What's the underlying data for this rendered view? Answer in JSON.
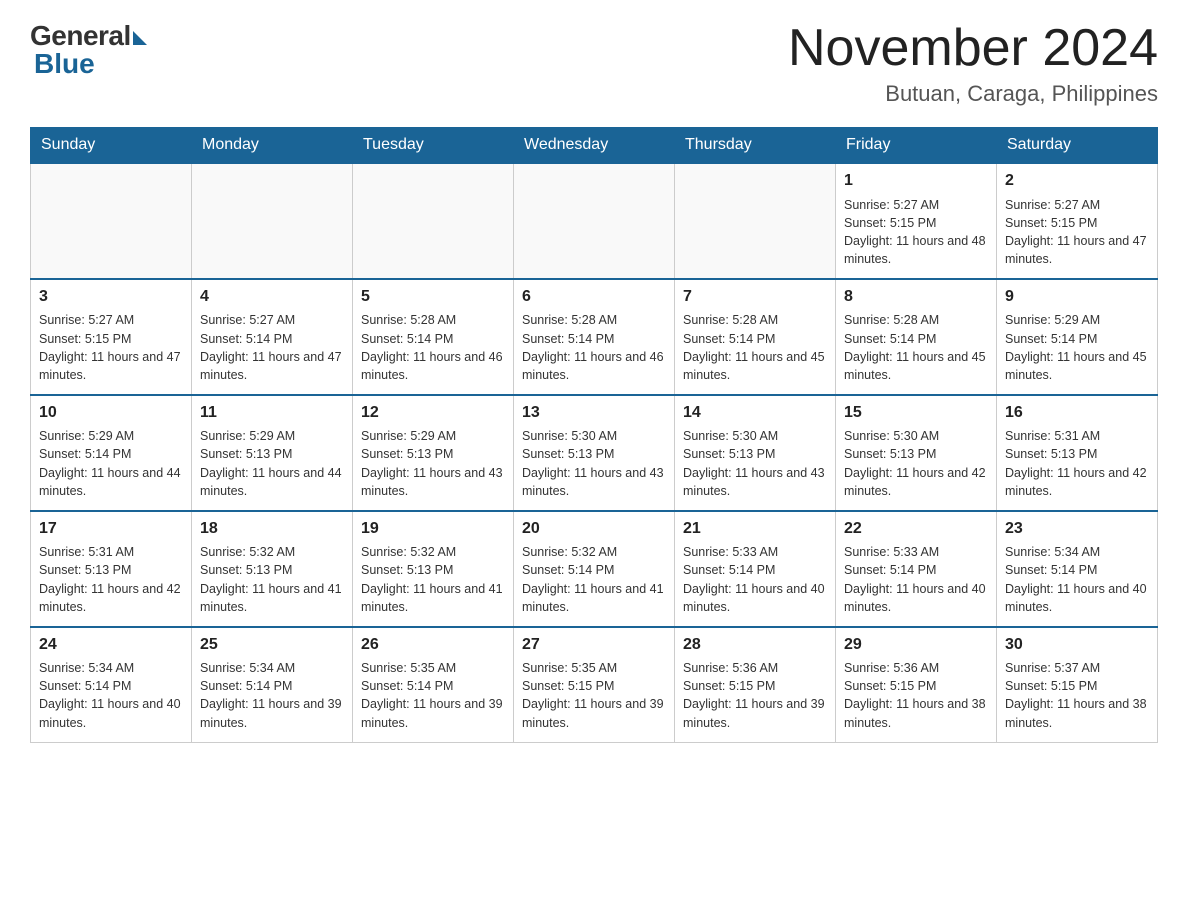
{
  "header": {
    "logo_general": "General",
    "logo_blue": "Blue",
    "title": "November 2024",
    "location": "Butuan, Caraga, Philippines"
  },
  "days_of_week": [
    "Sunday",
    "Monday",
    "Tuesday",
    "Wednesday",
    "Thursday",
    "Friday",
    "Saturday"
  ],
  "weeks": [
    [
      {
        "day": "",
        "info": ""
      },
      {
        "day": "",
        "info": ""
      },
      {
        "day": "",
        "info": ""
      },
      {
        "day": "",
        "info": ""
      },
      {
        "day": "",
        "info": ""
      },
      {
        "day": "1",
        "info": "Sunrise: 5:27 AM\nSunset: 5:15 PM\nDaylight: 11 hours and 48 minutes."
      },
      {
        "day": "2",
        "info": "Sunrise: 5:27 AM\nSunset: 5:15 PM\nDaylight: 11 hours and 47 minutes."
      }
    ],
    [
      {
        "day": "3",
        "info": "Sunrise: 5:27 AM\nSunset: 5:15 PM\nDaylight: 11 hours and 47 minutes."
      },
      {
        "day": "4",
        "info": "Sunrise: 5:27 AM\nSunset: 5:14 PM\nDaylight: 11 hours and 47 minutes."
      },
      {
        "day": "5",
        "info": "Sunrise: 5:28 AM\nSunset: 5:14 PM\nDaylight: 11 hours and 46 minutes."
      },
      {
        "day": "6",
        "info": "Sunrise: 5:28 AM\nSunset: 5:14 PM\nDaylight: 11 hours and 46 minutes."
      },
      {
        "day": "7",
        "info": "Sunrise: 5:28 AM\nSunset: 5:14 PM\nDaylight: 11 hours and 45 minutes."
      },
      {
        "day": "8",
        "info": "Sunrise: 5:28 AM\nSunset: 5:14 PM\nDaylight: 11 hours and 45 minutes."
      },
      {
        "day": "9",
        "info": "Sunrise: 5:29 AM\nSunset: 5:14 PM\nDaylight: 11 hours and 45 minutes."
      }
    ],
    [
      {
        "day": "10",
        "info": "Sunrise: 5:29 AM\nSunset: 5:14 PM\nDaylight: 11 hours and 44 minutes."
      },
      {
        "day": "11",
        "info": "Sunrise: 5:29 AM\nSunset: 5:13 PM\nDaylight: 11 hours and 44 minutes."
      },
      {
        "day": "12",
        "info": "Sunrise: 5:29 AM\nSunset: 5:13 PM\nDaylight: 11 hours and 43 minutes."
      },
      {
        "day": "13",
        "info": "Sunrise: 5:30 AM\nSunset: 5:13 PM\nDaylight: 11 hours and 43 minutes."
      },
      {
        "day": "14",
        "info": "Sunrise: 5:30 AM\nSunset: 5:13 PM\nDaylight: 11 hours and 43 minutes."
      },
      {
        "day": "15",
        "info": "Sunrise: 5:30 AM\nSunset: 5:13 PM\nDaylight: 11 hours and 42 minutes."
      },
      {
        "day": "16",
        "info": "Sunrise: 5:31 AM\nSunset: 5:13 PM\nDaylight: 11 hours and 42 minutes."
      }
    ],
    [
      {
        "day": "17",
        "info": "Sunrise: 5:31 AM\nSunset: 5:13 PM\nDaylight: 11 hours and 42 minutes."
      },
      {
        "day": "18",
        "info": "Sunrise: 5:32 AM\nSunset: 5:13 PM\nDaylight: 11 hours and 41 minutes."
      },
      {
        "day": "19",
        "info": "Sunrise: 5:32 AM\nSunset: 5:13 PM\nDaylight: 11 hours and 41 minutes."
      },
      {
        "day": "20",
        "info": "Sunrise: 5:32 AM\nSunset: 5:14 PM\nDaylight: 11 hours and 41 minutes."
      },
      {
        "day": "21",
        "info": "Sunrise: 5:33 AM\nSunset: 5:14 PM\nDaylight: 11 hours and 40 minutes."
      },
      {
        "day": "22",
        "info": "Sunrise: 5:33 AM\nSunset: 5:14 PM\nDaylight: 11 hours and 40 minutes."
      },
      {
        "day": "23",
        "info": "Sunrise: 5:34 AM\nSunset: 5:14 PM\nDaylight: 11 hours and 40 minutes."
      }
    ],
    [
      {
        "day": "24",
        "info": "Sunrise: 5:34 AM\nSunset: 5:14 PM\nDaylight: 11 hours and 40 minutes."
      },
      {
        "day": "25",
        "info": "Sunrise: 5:34 AM\nSunset: 5:14 PM\nDaylight: 11 hours and 39 minutes."
      },
      {
        "day": "26",
        "info": "Sunrise: 5:35 AM\nSunset: 5:14 PM\nDaylight: 11 hours and 39 minutes."
      },
      {
        "day": "27",
        "info": "Sunrise: 5:35 AM\nSunset: 5:15 PM\nDaylight: 11 hours and 39 minutes."
      },
      {
        "day": "28",
        "info": "Sunrise: 5:36 AM\nSunset: 5:15 PM\nDaylight: 11 hours and 39 minutes."
      },
      {
        "day": "29",
        "info": "Sunrise: 5:36 AM\nSunset: 5:15 PM\nDaylight: 11 hours and 38 minutes."
      },
      {
        "day": "30",
        "info": "Sunrise: 5:37 AM\nSunset: 5:15 PM\nDaylight: 11 hours and 38 minutes."
      }
    ]
  ]
}
